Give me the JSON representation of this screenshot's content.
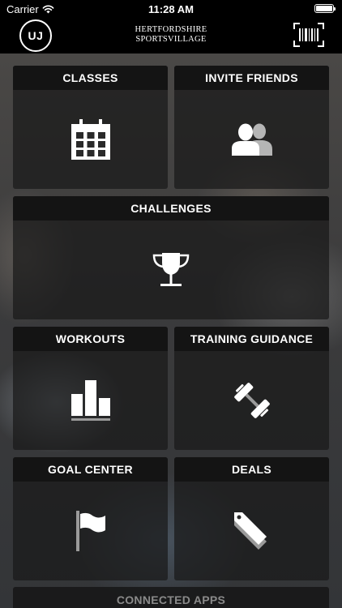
{
  "status_bar": {
    "carrier": "Carrier",
    "time": "11:28 AM"
  },
  "header": {
    "avatar_initials": "UJ",
    "brand_line1": "HERTFORDSHIRE",
    "brand_line2": "SPORTSVILLAGE",
    "barcode_icon": "barcode-scanner-icon"
  },
  "tiles": [
    {
      "label": "CLASSES",
      "icon": "calendar-icon"
    },
    {
      "label": "INVITE FRIENDS",
      "icon": "people-icon"
    },
    {
      "label": "CHALLENGES",
      "icon": "trophy-icon"
    },
    {
      "label": "WORKOUTS",
      "icon": "bar-chart-icon"
    },
    {
      "label": "TRAINING GUIDANCE",
      "icon": "dumbbell-icon"
    },
    {
      "label": "GOAL CENTER",
      "icon": "flag-icon"
    },
    {
      "label": "DEALS",
      "icon": "tag-icon"
    }
  ],
  "connected_apps_label": "CONNECTED APPS",
  "colors": {
    "tile_header": "#141414",
    "tile_body": "#191919",
    "icon": "#ffffff",
    "icon_secondary": "#b5b5b5"
  }
}
